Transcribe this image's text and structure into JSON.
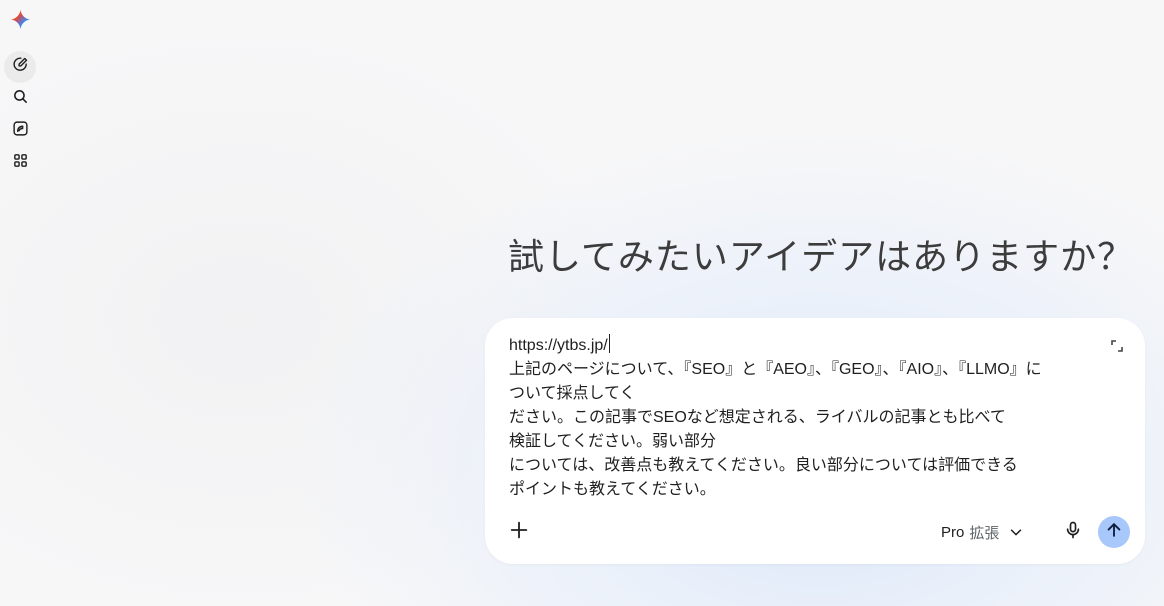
{
  "sidebar": {
    "logo_icon": "gemini-sparkle-icon",
    "items": [
      {
        "icon": "new-chat-icon",
        "active": true
      },
      {
        "icon": "search-icon",
        "active": false
      },
      {
        "icon": "gems-icon",
        "active": false
      },
      {
        "icon": "apps-grid-icon",
        "active": false
      }
    ]
  },
  "main": {
    "greeting": "試してみたいアイデアはありますか？"
  },
  "composer": {
    "prompt_lines": [
      "https://ytbs.jp/",
      "上記のページについて、『SEO』と『AEO』、『GEO』、『AIO』、『LLMO』に",
      "ついて採点してく",
      "ださい。この記事でSEOなど想定される、ライバルの記事とも比べて",
      "検証してください。弱い部分",
      "については、改善点も教えてください。良い部分については評価できる",
      "ポイントも教えてください。"
    ],
    "expand_icon": "expand-icon",
    "add_icon": "plus-icon",
    "mode_label": "Pro",
    "mode_sub_label": "拡張",
    "mode_icon": "chevron-down-icon",
    "mic_icon": "mic-icon",
    "send_icon": "arrow-up-icon",
    "send_color": "#a8c7fa"
  }
}
